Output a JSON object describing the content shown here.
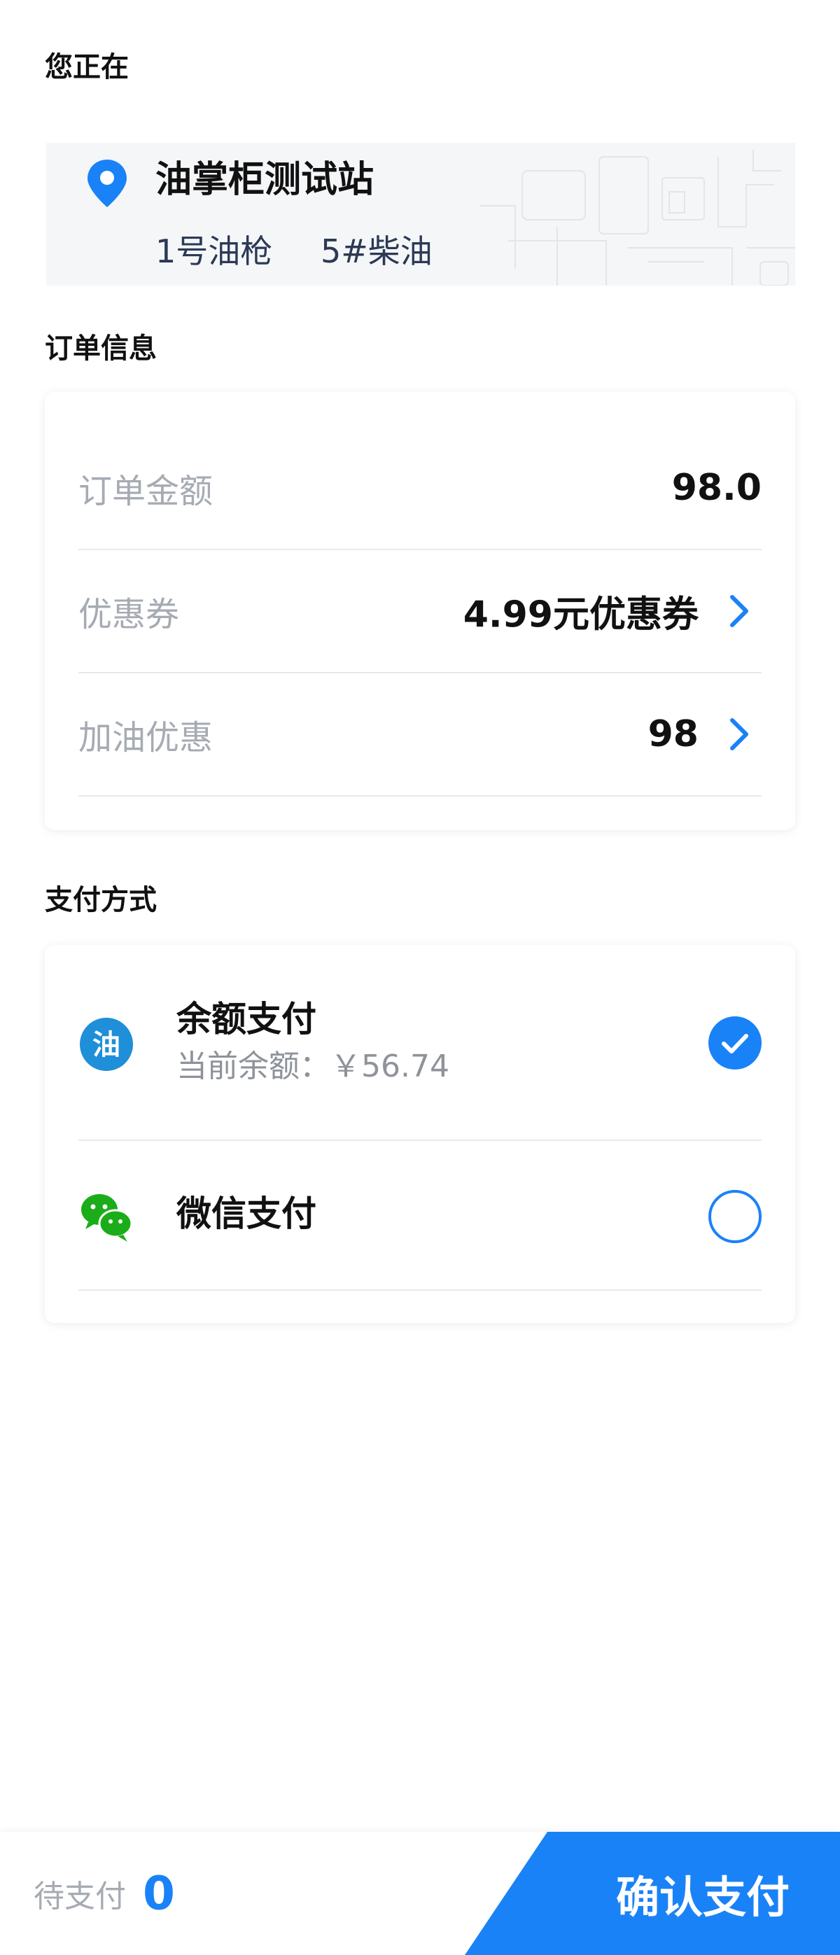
{
  "location": {
    "section_title": "您正在",
    "station_name": "油掌柜测试站",
    "nozzle": "1号油枪",
    "fuel_type": "5#柴油"
  },
  "order": {
    "section_title": "订单信息",
    "rows": [
      {
        "label": "订单金额",
        "value": "98.0",
        "has_arrow": false
      },
      {
        "label": "优惠券",
        "value": "4.99元优惠券",
        "has_arrow": true
      },
      {
        "label": "加油优惠",
        "value": "98",
        "has_arrow": true
      }
    ]
  },
  "payment": {
    "section_title": "支付方式",
    "methods": [
      {
        "name": "余额支付",
        "subtitle": "当前余额：￥56.74",
        "icon": "oil-balance-icon",
        "icon_glyph": "油",
        "selected": true
      },
      {
        "name": "微信支付",
        "icon": "wechat-icon",
        "selected": false
      }
    ]
  },
  "footer": {
    "pending_label": "待支付",
    "pending_amount": "0",
    "confirm_label": "确认支付"
  },
  "colors": {
    "accent": "#1a82f7",
    "wechat_green": "#1aad19",
    "balance_icon_blue": "#1e8fd8",
    "muted_text": "#a6abb3"
  }
}
